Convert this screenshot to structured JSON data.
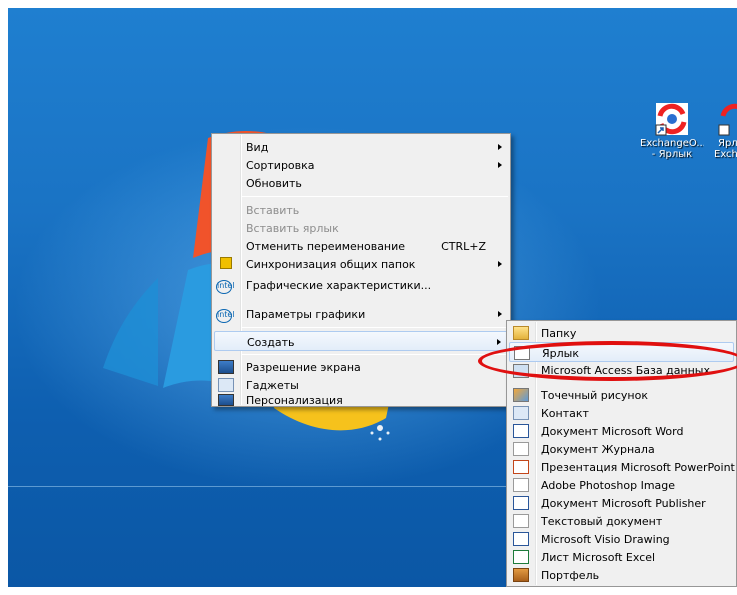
{
  "desktop_icons": [
    {
      "label_line1": "ExchangeO...",
      "label_line2": "- Ярлык"
    },
    {
      "label_line1": "Ярл",
      "label_line2": "Exch"
    }
  ],
  "context_menu": {
    "items": [
      {
        "label": "Вид"
      },
      {
        "label": "Сортировка"
      },
      {
        "label": "Обновить"
      },
      {
        "label": "Вставить"
      },
      {
        "label": "Вставить ярлык"
      },
      {
        "label": "Отменить переименование",
        "shortcut": "CTRL+Z"
      },
      {
        "label": "Синхронизация общих папок",
        "icon": "sync-icon"
      },
      {
        "label": "Графические характеристики...",
        "icon": "intel-icon",
        "icon_text": "intel"
      },
      {
        "label": "Параметры графики",
        "icon": "intel-icon",
        "icon_text": "intel"
      },
      {
        "label": "Создать"
      },
      {
        "label": "Разрешение экрана",
        "icon": "monitor-icon"
      },
      {
        "label": "Гаджеты",
        "icon": "gadgets-icon"
      },
      {
        "label": "Персонализация",
        "icon": "personalization-icon"
      }
    ]
  },
  "submenu": {
    "items": [
      {
        "label": "Папку",
        "icon": "folder-icon"
      },
      {
        "label": "Ярлык",
        "icon": "shortcut-icon"
      },
      {
        "label": "Microsoft Access База данных",
        "icon": "access-icon"
      },
      {
        "label": "Точечный рисунок",
        "icon": "bitmap-icon"
      },
      {
        "label": "Контакт",
        "icon": "contact-icon"
      },
      {
        "label": "Документ Microsoft Word",
        "icon": "word-icon"
      },
      {
        "label": "Документ Журнала",
        "icon": "journal-icon"
      },
      {
        "label": "Презентация Microsoft PowerPoint",
        "icon": "powerpoint-icon"
      },
      {
        "label": "Adobe Photoshop Image",
        "icon": "photoshop-icon"
      },
      {
        "label": "Документ Microsoft Publisher",
        "icon": "publisher-icon"
      },
      {
        "label": "Текстовый документ",
        "icon": "text-document-icon"
      },
      {
        "label": "Microsoft Visio Drawing",
        "icon": "visio-icon"
      },
      {
        "label": "Лист Microsoft Excel",
        "icon": "excel-icon"
      },
      {
        "label": "Портфель",
        "icon": "briefcase-icon"
      }
    ]
  },
  "colors": {
    "highlight_ellipse": "#e01010",
    "desktop_blue": "#1a73c4"
  }
}
